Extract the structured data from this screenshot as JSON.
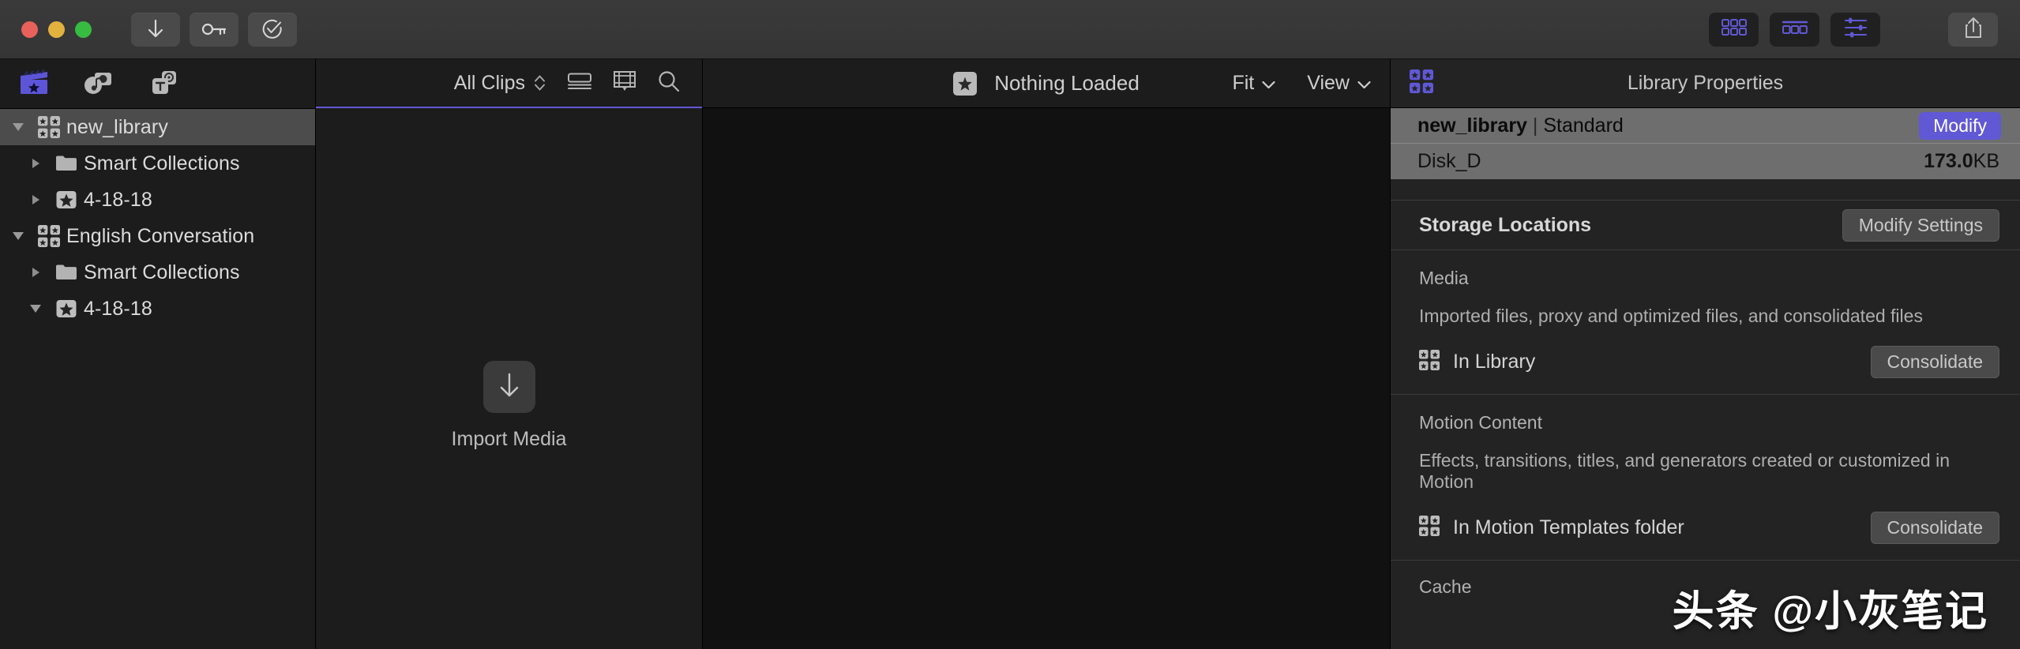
{
  "titlebar": {
    "traffic_lights": [
      {
        "name": "close",
        "color": "#e8615a"
      },
      {
        "name": "minimize",
        "color": "#e2b23e"
      },
      {
        "name": "zoom",
        "color": "#37bc42"
      }
    ],
    "left_buttons": [
      {
        "name": "import-media-button",
        "icon": "download-arrow-icon"
      },
      {
        "name": "keyword-editor-button",
        "icon": "key-icon"
      },
      {
        "name": "background-tasks-button",
        "icon": "check-circle-icon"
      }
    ],
    "right_buttons": [
      {
        "name": "browser-toggle-button",
        "icon": "grid-2x3-icon",
        "active": true
      },
      {
        "name": "timeline-toggle-button",
        "icon": "timeline-icon",
        "active": true
      },
      {
        "name": "inspector-toggle-button",
        "icon": "sliders-icon",
        "active": true
      },
      {
        "name": "share-button",
        "icon": "share-upload-icon",
        "active": false
      }
    ],
    "accent_color": "#6158d6"
  },
  "sidebar": {
    "tabs": [
      {
        "name": "libraries-tab",
        "icon": "clapperboard-star-icon",
        "active": true
      },
      {
        "name": "photos-audio-tab",
        "icon": "photos-audio-icon",
        "active": false
      },
      {
        "name": "titles-generators-tab",
        "icon": "titles-generators-icon",
        "active": false
      }
    ],
    "tree": [
      {
        "label": "new_library",
        "icon": "library-icon",
        "level": 0,
        "expanded": true,
        "selected": true
      },
      {
        "label": "Smart Collections",
        "icon": "folder-icon",
        "level": 1,
        "expanded": false,
        "selected": false
      },
      {
        "label": "4-18-18",
        "icon": "event-star-icon",
        "level": 1,
        "expanded": false,
        "selected": false
      },
      {
        "label": "English Conversation",
        "icon": "library-icon",
        "level": 0,
        "expanded": true,
        "selected": false
      },
      {
        "label": "Smart Collections",
        "icon": "folder-icon",
        "level": 1,
        "expanded": false,
        "selected": false
      },
      {
        "label": "4-18-18",
        "icon": "event-star-icon",
        "level": 1,
        "expanded": true,
        "selected": false
      }
    ]
  },
  "browser": {
    "filter_label": "All Clips",
    "icons": [
      {
        "name": "list-view-icon"
      },
      {
        "name": "filmstrip-view-icon"
      },
      {
        "name": "search-icon"
      }
    ],
    "empty_state": {
      "label": "Import Media",
      "icon": "download-arrow-icon"
    },
    "underline_color": "#6158d6"
  },
  "viewer": {
    "badge_icon": "star-badge-icon",
    "title": "Nothing Loaded",
    "zoom_menu": "Fit",
    "view_menu": "View"
  },
  "inspector": {
    "header_icon": "library-icon",
    "title": "Library Properties",
    "selected": {
      "library_name": "new_library",
      "separator": "|",
      "library_type": "Standard",
      "modify_button": "Modify",
      "disk_label": "Disk_D",
      "disk_size_value": "173.0",
      "disk_size_unit": "KB"
    },
    "storage": {
      "section_title": "Storage Locations",
      "modify_settings_button": "Modify Settings",
      "groups": [
        {
          "title": "Media",
          "description": "Imported files, proxy and optimized files, and consolidated files",
          "location_icon": "library-icon",
          "location": "In Library",
          "action": "Consolidate"
        },
        {
          "title": "Motion Content",
          "description": "Effects, transitions, titles, and generators created or customized in Motion",
          "location_icon": "library-icon",
          "location": "In Motion Templates folder",
          "action": "Consolidate"
        },
        {
          "title": "Cache",
          "description": "",
          "location_icon": "",
          "location": "",
          "action": ""
        }
      ]
    }
  },
  "watermark": "头条 @小灰笔记"
}
